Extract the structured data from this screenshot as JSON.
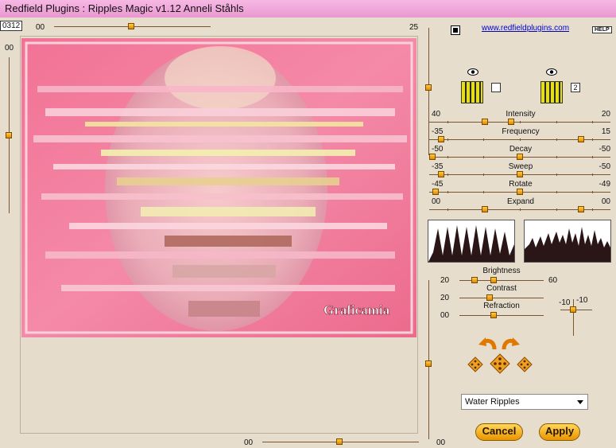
{
  "titlebar": {
    "title": "Redfield Plugins : Ripples Magic v1.12   Anneli Ståhls"
  },
  "top": {
    "frame_number": "0312",
    "slider_left_value": "00",
    "slider_right_value": "25",
    "link": "www.redfieldplugins.com",
    "help": "HELP"
  },
  "left_slider": {
    "value": "00"
  },
  "bottom_slider": {
    "left_value": "00",
    "right_value": "00"
  },
  "preview": {
    "watermark": "Graficamia"
  },
  "params": [
    {
      "left": "40",
      "name": "Intensity",
      "right": "20",
      "thumb_a": 0.3,
      "thumb_b": 0.45
    },
    {
      "left": "-35",
      "name": "Frequency",
      "right": "15",
      "thumb_a": 0.05,
      "thumb_b": 0.85
    },
    {
      "left": "-50",
      "name": "Decay",
      "right": "-50",
      "thumb_a": 0.0,
      "thumb_b": 0.5
    },
    {
      "left": "-35",
      "name": "Sweep",
      "right": "-50",
      "thumb_a": 0.05,
      "thumb_b": 0.5
    },
    {
      "left": "-45",
      "name": "Rotate",
      "right": "-49",
      "thumb_a": 0.02,
      "thumb_b": 0.5
    },
    {
      "left": "00",
      "name": "Expand",
      "right": "00",
      "thumb_a": 0.3,
      "thumb_b": 0.85
    }
  ],
  "lower_params": [
    {
      "name": "Brightness",
      "left": "20",
      "right": "60",
      "thumb_a": 0.15,
      "thumb_b": 0.4
    },
    {
      "name": "Contrast",
      "left": "20",
      "thumb_a": 0.35
    },
    {
      "name": "Refraction",
      "left": "00",
      "thumb_a": 0.4
    }
  ],
  "crosshair": {
    "x_value": "-10",
    "y_value": "-10"
  },
  "swatches": {
    "second_label": "2"
  },
  "dropdown": {
    "selected": "Water Ripples"
  },
  "buttons": {
    "cancel": "Cancel",
    "apply": "Apply"
  },
  "colors": {
    "titlebar": "#f0a8dc",
    "accent": "#e89400",
    "background": "#e6ddcd",
    "preview_pink": "#f06a8c"
  },
  "icons": [
    "eye-icon",
    "eye-icon",
    "rotate-left-arrow-icon",
    "rotate-right-arrow-icon",
    "dice-icon",
    "dice-icon",
    "dice-icon",
    "dropdown-arrow-icon"
  ]
}
